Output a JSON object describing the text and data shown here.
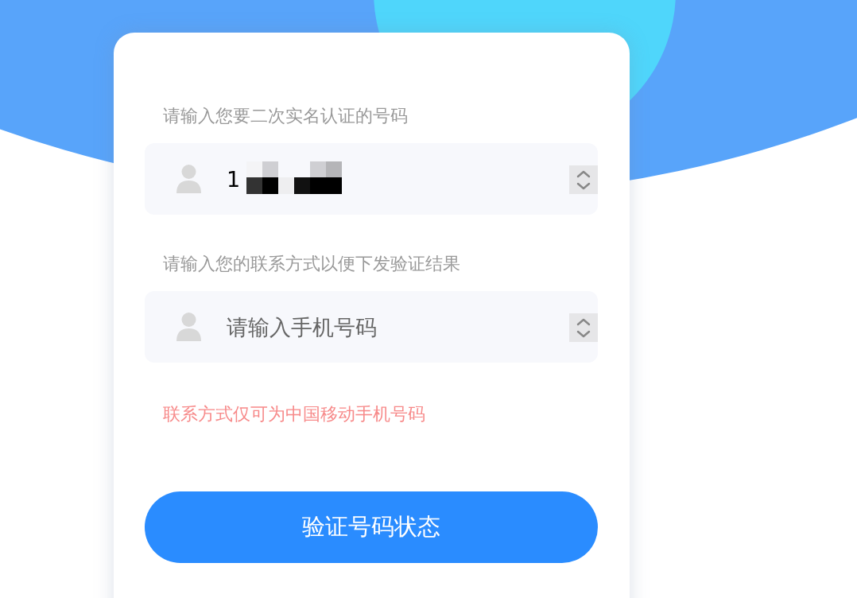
{
  "form": {
    "fields": [
      {
        "label": "请输入您要二次实名认证的号码",
        "value": "1",
        "redacted": true
      },
      {
        "label": "请输入您的联系方式以便下发验证结果",
        "placeholder": "请输入手机号码"
      }
    ],
    "notice": "联系方式仅可为中国移动手机号码",
    "submit": "验证号码状态"
  }
}
